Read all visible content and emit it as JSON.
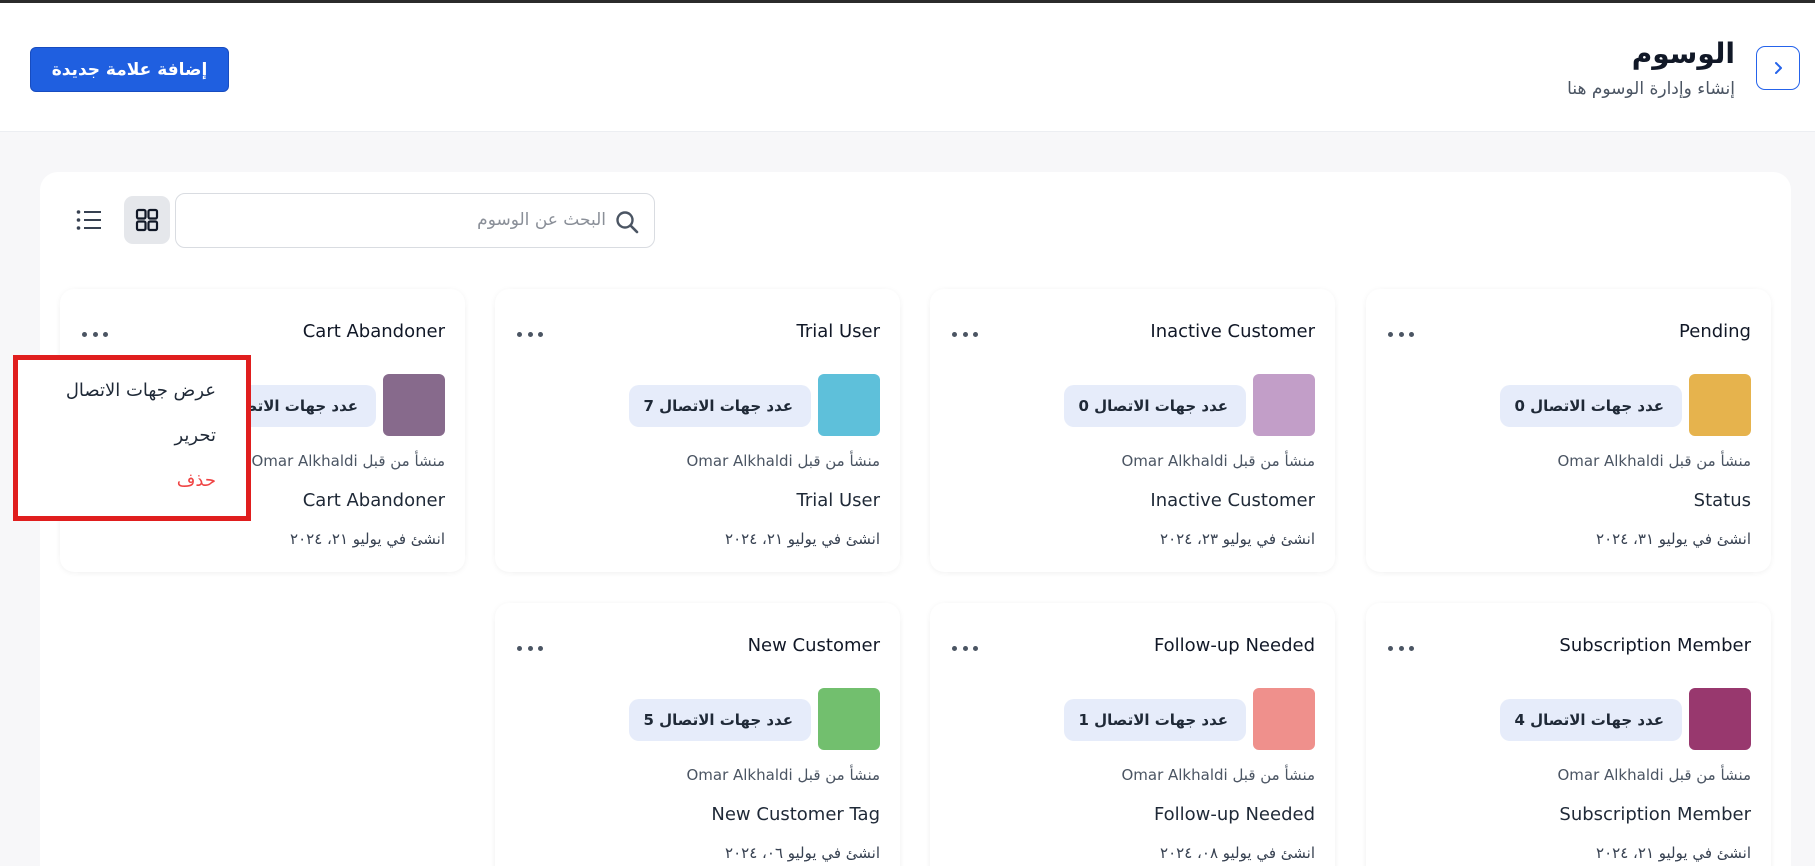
{
  "header": {
    "title": "الوسوم",
    "subtitle": "إنشاء وإدارة الوسوم هنا",
    "add_button": "إضافة علامة جديدة"
  },
  "toolbar": {
    "search_placeholder": "البحث عن الوسوم"
  },
  "cards": [
    {
      "title": "Pending",
      "color": "#e6b34d",
      "count_label": "عدد جهات الاتصال 0",
      "creator": "منشأ من قبل Omar Alkhaldi",
      "description": "Status",
      "date": "انشئ في يوليو ٣١، ٢٠٢٤"
    },
    {
      "title": "Inactive Customer",
      "color": "#c29ec8",
      "count_label": "عدد جهات الاتصال 0",
      "creator": "منشأ من قبل Omar Alkhaldi",
      "description": "Inactive Customer",
      "date": "انشئ في يوليو ٢٣، ٢٠٢٤"
    },
    {
      "title": "Trial User",
      "color": "#5ec0da",
      "count_label": "عدد جهات الاتصال 7",
      "creator": "منشأ من قبل Omar Alkhaldi",
      "description": "Trial User",
      "date": "انشئ في يوليو ٢١، ٢٠٢٤"
    },
    {
      "title": "Cart Abandoner",
      "color": "#876a8c",
      "count_label": "عدد جهات الاتصال",
      "creator": "منشأ من قبل Omar Alkhaldi",
      "description": "Cart Abandoner",
      "date": "انشئ في يوليو ٢١، ٢٠٢٤"
    },
    {
      "title": "Subscription Member",
      "color": "#98386e",
      "count_label": "عدد جهات الاتصال 4",
      "creator": "منشأ من قبل Omar Alkhaldi",
      "description": "Subscription Member",
      "date": "انشئ في يوليو ٢١، ٢٠٢٤"
    },
    {
      "title": "Follow-up Needed",
      "color": "#ef908c",
      "count_label": "عدد جهات الاتصال 1",
      "creator": "منشأ من قبل Omar Alkhaldi",
      "description": "Follow-up Needed",
      "date": "انشئ في يوليو ٠٨، ٢٠٢٤"
    },
    {
      "title": "New Customer",
      "color": "#72bf6e",
      "count_label": "عدد جهات الاتصال 5",
      "creator": "منشأ من قبل Omar Alkhaldi",
      "description": "New Customer Tag",
      "date": "انشئ في يوليو ٠٦، ٢٠٢٤"
    }
  ],
  "popup_menu": {
    "view_contacts": "عرض جهات الاتصال",
    "edit": "تحرير",
    "delete": "حذف"
  },
  "colors": {
    "accent": "#1f5fe0",
    "delete": "#ef4444",
    "highlight_border": "#e01e1e"
  },
  "icons": {
    "back": "chevron-right-icon",
    "search": "search-icon",
    "grid": "grid-icon",
    "list": "list-icon",
    "menu": "more-horizontal-icon"
  }
}
